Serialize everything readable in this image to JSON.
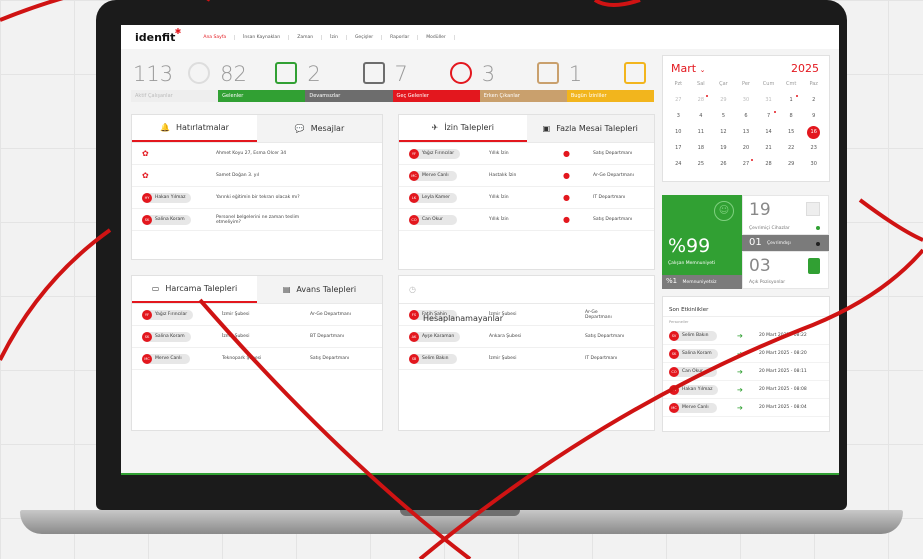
{
  "nav": {
    "logo": "idenfit",
    "items": [
      "Ana Sayfa",
      "İnsan Kaynakları",
      "Zaman",
      "İzin",
      "Geçişler",
      "Raporlar",
      "Modüller"
    ]
  },
  "stats": [
    {
      "num": "113",
      "label": "Aktif Çalışanlar",
      "color": "#eeeeee",
      "labelColor": "#bbbbbb",
      "icon": "person-icon"
    },
    {
      "num": "82",
      "label": "Gelenler",
      "color": "#31a033",
      "labelColor": "#ffffff",
      "icon": "login-icon"
    },
    {
      "num": "2",
      "label": "Devamsızlar",
      "color": "#6d6d6d",
      "labelColor": "#ffffff",
      "icon": "absent-icon"
    },
    {
      "num": "7",
      "label": "Geç Gelenler",
      "color": "#e3171e",
      "labelColor": "#ffffff",
      "icon": "alarm-icon"
    },
    {
      "num": "3",
      "label": "Erken Çıkanlar",
      "color": "#c9a06d",
      "labelColor": "#ffffff",
      "icon": "calendar-clock-icon"
    },
    {
      "num": "1",
      "label": "Bugün İzinliler",
      "color": "#f2b51d",
      "labelColor": "#ffffff",
      "icon": "plane-icon"
    }
  ],
  "reminders": {
    "tab1": "Hatırlatmalar",
    "tab2": "Mesajlar",
    "rows": [
      {
        "who": "",
        "text": "Ahmet Koyu 27, Esma Olcer 34",
        "icon": "cake-icon"
      },
      {
        "who": "",
        "text": "Samet Doğan 3. yıl",
        "icon": "badge-icon"
      },
      {
        "who": "Hakan Yılmaz",
        "av": "HY",
        "text": "Yarınki eğitimin bir tekrarı olacak mı?"
      },
      {
        "who": "Salina Koram",
        "av": "SK",
        "text": "Personel belgelerini ne zaman teslim etmeliyim?"
      }
    ]
  },
  "leave": {
    "tab1": "İzin Talepleri",
    "tab2": "Fazla Mesai Talepleri",
    "rows": [
      {
        "who": "Yağız Fırıncılar",
        "av": "YF",
        "type": "Yıllık İzin",
        "dept": "Satış Departmanı"
      },
      {
        "who": "Merve Canlı",
        "av": "MC",
        "type": "Hastalık İzin",
        "dept": "Ar-Ge Departmanı"
      },
      {
        "who": "Leyla Kamer",
        "av": "LK",
        "type": "Yıllık İzin",
        "dept": "IT Departmanı"
      },
      {
        "who": "Can Okur",
        "av": "CO",
        "type": "Yıllık İzin",
        "dept": "Satış Departmanı"
      }
    ]
  },
  "expense": {
    "tab1": "Harcama Talepleri",
    "tab2": "Avans Talepleri",
    "rows": [
      {
        "who": "Yağız Fırıncılar",
        "av": "YF",
        "branch": "İzmir Şubesi",
        "dept": "Ar-Ge Departmanı"
      },
      {
        "who": "Salina Koram",
        "av": "SK",
        "branch": "İzmir Şubesi",
        "dept": "BT Departmanı"
      },
      {
        "who": "Merve Canlı",
        "av": "MC",
        "branch": "Teknopark Şubesi",
        "dept": "Satış Departmanı"
      }
    ]
  },
  "unscheduled": {
    "title": "Hesaplanamayanlar",
    "rows": [
      {
        "who": "Fatih Şahin",
        "av": "FS",
        "branch": "İzmir Şubesi",
        "dept": "Ar-Ge Departmanı"
      },
      {
        "who": "Ayşe Karaman",
        "av": "AK",
        "branch": "Ankara Şubesi",
        "dept": "Satış Departmanı"
      },
      {
        "who": "Selim Bakın",
        "av": "SB",
        "branch": "İzmir Şubesi",
        "dept": "IT Departmanı"
      }
    ]
  },
  "calendar": {
    "month": "Mart",
    "year": "2025",
    "days": [
      "Pzt",
      "Sal",
      "Çar",
      "Per",
      "Cum",
      "Cmt",
      "Paz"
    ],
    "cells": [
      "27",
      "28",
      "29",
      "30",
      "31",
      "1",
      "2",
      "3",
      "4",
      "5",
      "6",
      "7",
      "8",
      "9",
      "10",
      "11",
      "12",
      "13",
      "14",
      "15",
      "16",
      "17",
      "18",
      "19",
      "20",
      "21",
      "22",
      "23",
      "24",
      "25",
      "26",
      "27",
      "28",
      "29",
      "30"
    ]
  },
  "mood": {
    "percent": "%99",
    "label": "Çalışan Memnuniyeti",
    "sub_percent": "%1",
    "sub_label": "Memnuniyetsiz",
    "online": "19",
    "online_label": "Çevrimiçi Cihazlar",
    "offline": "01",
    "offline_label": "Çevrimdışı",
    "positions": "03",
    "positions_label": "Açık Pozisyonlar"
  },
  "events": {
    "title": "Son Etkinlikler",
    "sub": "Personeller",
    "rows": [
      {
        "who": "Selim Bakın",
        "av": "SV",
        "time": "20 Mart 2025 - 08:22"
      },
      {
        "who": "Salina Koram",
        "av": "SK",
        "time": "20 Mart 2025 - 08:20"
      },
      {
        "who": "Can Okur",
        "av": "CO",
        "time": "20 Mart 2025 - 08:11"
      },
      {
        "who": "Hakan Yılmaz",
        "av": "HY",
        "time": "20 Mart 2025 - 08:08"
      },
      {
        "who": "Merve Canlı",
        "av": "MC",
        "time": "20 Mart 2025 - 08:04"
      }
    ]
  },
  "colors": {
    "accent": "#e3171e",
    "green": "#31a033"
  }
}
